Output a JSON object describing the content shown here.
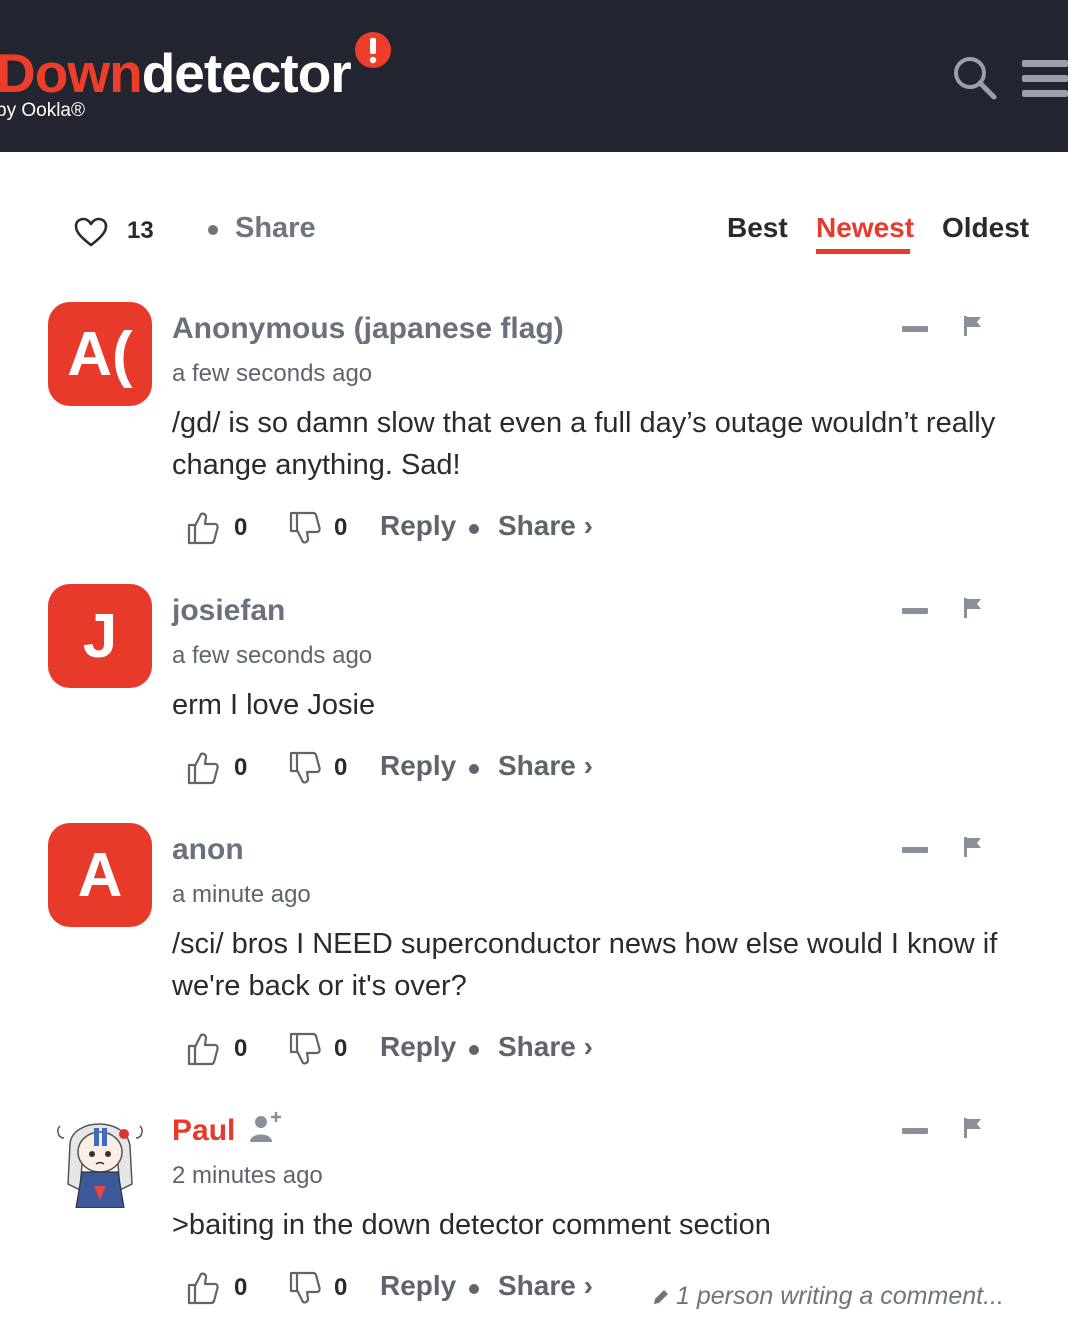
{
  "header": {
    "logo_down": "Down",
    "logo_detector": "detector",
    "logo_sub": "by Ookla®",
    "brand_colors": {
      "red": "#ee3e2b",
      "dark": "#232631"
    },
    "search_icon": "search-icon",
    "menu_icon": "hamburger-menu-icon"
  },
  "toolbar": {
    "like_count": "13",
    "share_label": "Share",
    "sort_tabs": [
      {
        "label": "Best",
        "active": false
      },
      {
        "label": "Newest",
        "active": true
      },
      {
        "label": "Oldest",
        "active": false
      }
    ]
  },
  "comments": [
    {
      "avatar_text": "A(",
      "author": "Anonymous (japanese flag)",
      "time": "a few seconds ago",
      "body": "/gd/ is so damn slow that even a full day’s outage wouldn’t really change anything. Sad!",
      "upvotes": "0",
      "downvotes": "0",
      "reply_label": "Reply",
      "share_label": "Share ›"
    },
    {
      "avatar_text": "J",
      "author": "josiefan",
      "time": "a few seconds ago",
      "body": "erm I love Josie",
      "upvotes": "0",
      "downvotes": "0",
      "reply_label": "Reply",
      "share_label": "Share ›"
    },
    {
      "avatar_text": "A",
      "author": "anon",
      "time": "a minute ago",
      "body": "/sci/ bros I NEED superconductor news how else would I know if we're back or it's over?",
      "upvotes": "0",
      "downvotes": "0",
      "reply_label": "Reply",
      "share_label": "Share ›"
    },
    {
      "avatar_text": "",
      "author": "Paul",
      "time": "2 minutes ago",
      "body": ">baiting in the down detector comment section",
      "upvotes": "0",
      "downvotes": "0",
      "reply_label": "Reply",
      "share_label": "Share ›"
    }
  ],
  "typing_indicator": "1 person writing a comment..."
}
